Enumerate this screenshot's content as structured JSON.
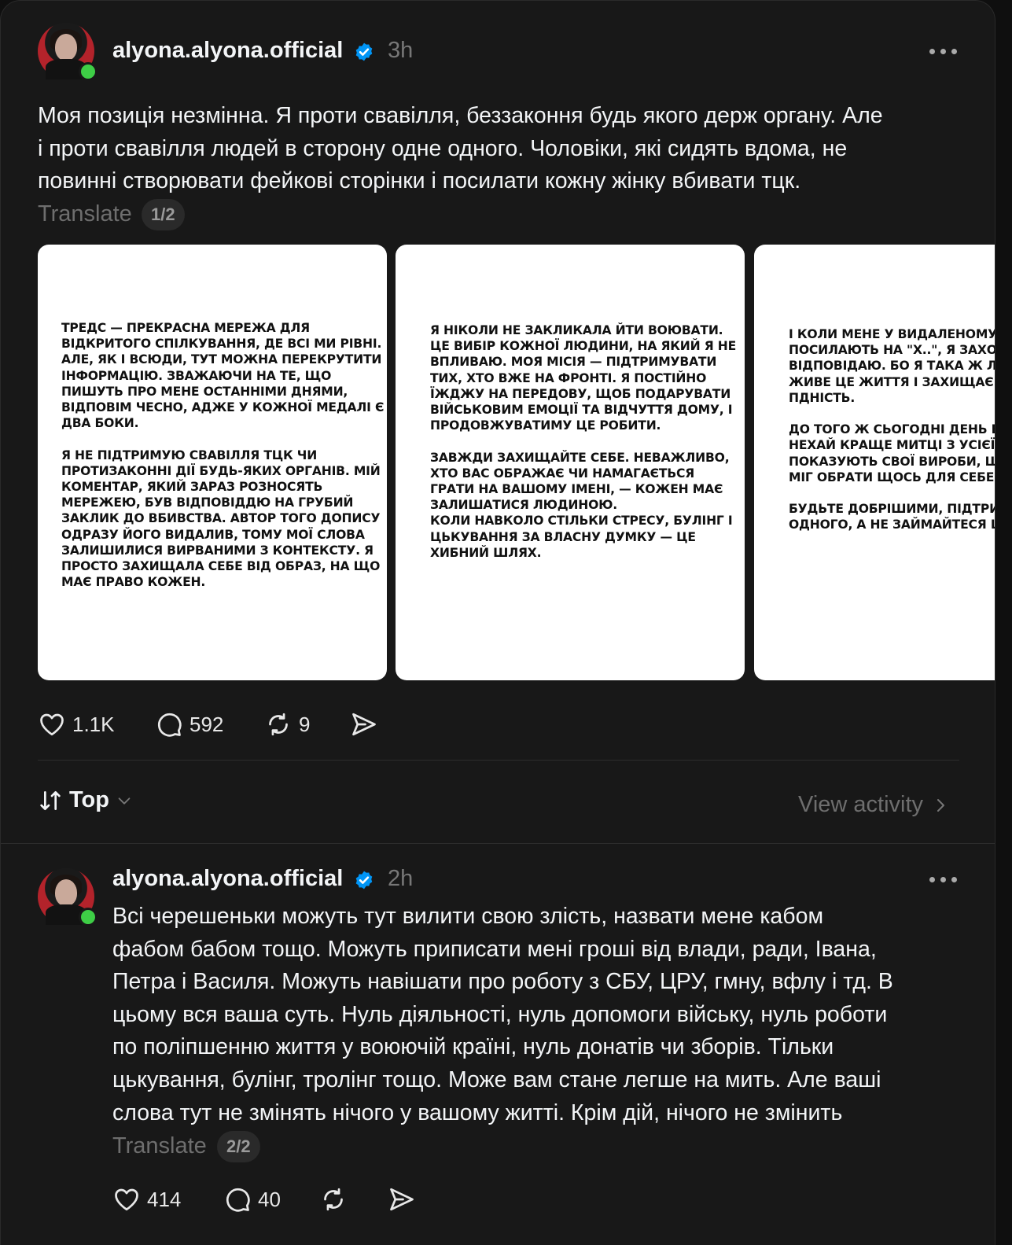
{
  "post": {
    "username": "alyona.alyona.official",
    "time": "3h",
    "lines": [
      "Моя позиція незмінна. Я проти свавілля, беззаконня будь якого держ органу. Але",
      "і проти свавілля людей в сторону одне одного. Чоловіки, які сидять вдома, не",
      "повинні створювати фейкові сторінки і посилати кожну жінку вбивати тцк."
    ],
    "translate_label": "Translate",
    "pager": "1/2",
    "images": [
      {
        "text": "ТРЕДС — ПРЕКРАСНА МЕРЕЖА ДЛЯ\nВІДКРИТОГО СПІЛКУВАННЯ, ДЕ ВСІ МИ РІВНІ.\nАЛЕ, ЯК І ВСЮДИ, ТУТ МОЖНА ПЕРЕКРУТИТИ\nІНФОРМАЦІЮ. ЗВАЖАЮЧИ НА ТЕ, ЩО\nПИШУТЬ ПРО МЕНЕ ОСТАННІМИ ДНЯМИ,\nВІДПОВІМ ЧЕСНО, АДЖЕ У КОЖНОЇ МЕДАЛІ Є\nДВА БОКИ.\n\nЯ НЕ ПІДТРИМУЮ СВАВІЛЛЯ ТЦК ЧИ\nПРОТИЗАКОННІ ДІЇ БУДЬ-ЯКИХ ОРГАНІВ. МІЙ\nКОМЕНТАР, ЯКИЙ ЗАРАЗ РОЗНОСЯТЬ\nМЕРЕЖЕЮ, БУВ ВІДПОВІДДЮ НА ГРУБИЙ\nЗАКЛИК ДО ВБИВСТВА. АВТОР ТОГО ДОПИСУ\nОДРАЗУ ЙОГО ВИДАЛИВ, ТОМУ МОЇ СЛОВА\nЗАЛИШИЛИСЯ ВИРВАНИМИ З КОНТЕКСТУ. Я\nПРОСТО ЗАХИЩАЛА СЕБЕ ВІД ОБРАЗ, НА ЩО\nМАЄ ПРАВО КОЖЕН."
      },
      {
        "text": "Я НІКОЛИ НЕ ЗАКЛИКАЛА ЙТИ ВОЮВАТИ.\nЦЕ ВИБІР КОЖНОЇ ЛЮДИНИ, НА ЯКИЙ Я НЕ\nВПЛИВАЮ. МОЯ МІСІЯ — ПІДТРИМУВАТИ\nТИХ, ХТО ВЖЕ НА ФРОНТІ. Я ПОСТІЙНО\nЇЖДЖУ НА ПЕРЕДОВУ, ЩОБ ПОДАРУВАТИ\nВІЙСЬКОВИМ ЕМОЦІЇ ТА ВІДЧУТТЯ ДОМУ, І\nПРОДОВЖУВАТИМУ ЦЕ РОБИТИ.\n\nЗАВЖДИ ЗАХИЩАЙТЕ СЕБЕ. НЕВАЖЛИВО,\nХТО ВАС ОБРАЖАЄ ЧИ НАМАГАЄТЬСЯ\nГРАТИ НА ВАШОМУ ІМЕНІ, — КОЖЕН МАЄ\nЗАЛИШАТИСЯ ЛЮДИНОЮ.\nКОЛИ НАВКОЛО СТІЛЬКИ СТРЕСУ, БУЛІНГ І\nЦЬКУВАННЯ ЗА ВЛАСНУ ДУМКУ — ЦЕ\nХИБНИЙ ШЛЯХ."
      },
      {
        "text": "І КОЛИ МЕНЕ У ВИДАЛЕНОМУ ДО\nПОСИЛАЮТЬ НА \"Х..\", Я ЗАХОДЖ\nВІДПОВІДАЮ. БО Я ТАКА Ж ЛЮД\nЖИВЕ ЦЕ ЖИТТЯ І ЗАХИЩАЄ ВЛА\nПДНІСТЬ.\n\nДО ТОГО Ж СЬОГОДНІ ДЕНЬ ВИ\nНЕХАЙ КРАЩЕ МИТЦІ З УСІЄЇ УК\nПОКАЗУЮТЬ СВОЇ ВИРОБИ, ЩОБ\nМІГ ОБРАТИ ЩОСЬ ДЛЯ СЕБЕ ТА\n\nБУДЬТЕ ДОБРІШИМИ, ПІДТРИМУЙ\nОДНОГО, А НЕ ЗАЙМАЙТЕСЯ ЦЬ"
      }
    ],
    "likes": "1.1K",
    "comments": "592",
    "reposts": "9"
  },
  "sort": {
    "label": "Top",
    "view_activity": "View activity"
  },
  "reply": {
    "username": "alyona.alyona.official",
    "time": "2h",
    "lines": [
      "Всі черешеньки можуть тут вилити свою злість, назвати мене кабом",
      "фабом бабом тощо. Можуть приписати мені гроші від влади, ради, Івана,",
      "Петра і Василя. Можуть навішати про роботу з СБУ, ЦРУ, гмну, вфлу і тд. В",
      "цьому вся ваша суть. Нуль діяльності, нуль допомоги війську, нуль роботи",
      "по поліпшенню життя у воюючій країні, нуль донатів чи зборів. Тільки",
      "цькування, булінг, тролінг тощо. Може вам стане легше на мить. Але ваші",
      "слова тут не змінять нічого у вашому житті. Крім дій, нічого не змінить"
    ],
    "translate_label": "Translate",
    "pager": "2/2",
    "likes": "414",
    "comments": "40"
  },
  "colors": {
    "background": "#181818",
    "verified": "#0095f6",
    "online": "#3ece46",
    "muted_text": "#6e6e6e"
  },
  "icons": [
    "verified-badge-icon",
    "more-icon",
    "heart-icon",
    "comment-icon",
    "repost-icon",
    "share-icon",
    "sort-icon",
    "chevron-down-icon",
    "chevron-right-icon"
  ]
}
